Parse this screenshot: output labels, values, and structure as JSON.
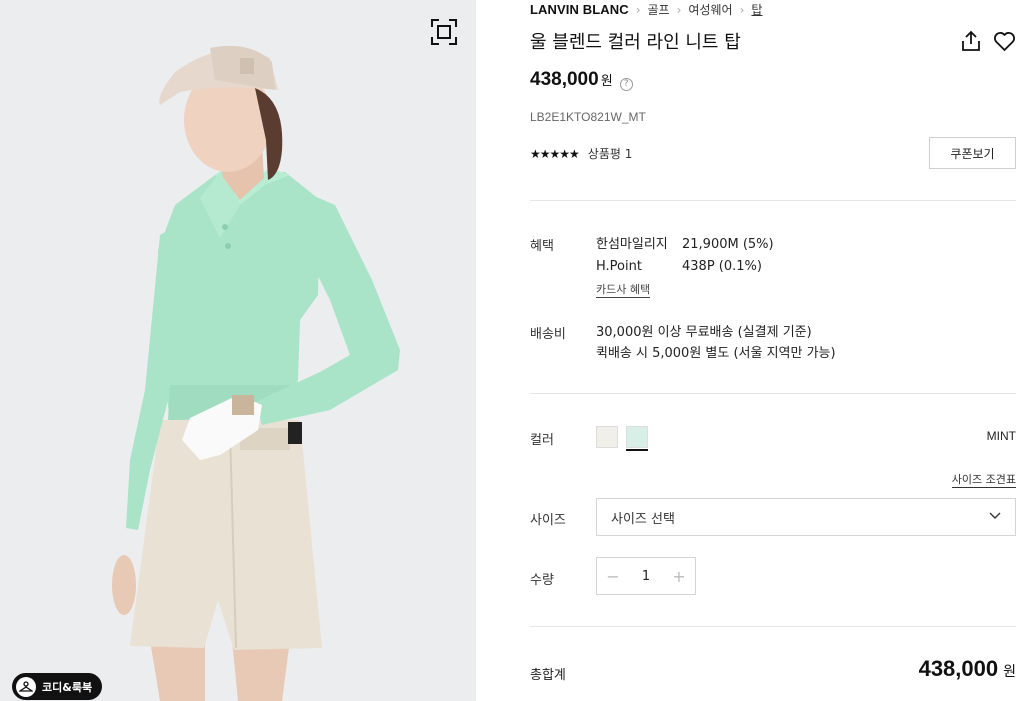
{
  "product_image": {
    "alt": "",
    "lookbook_label": "코디&룩북"
  },
  "breadcrumb": {
    "brand": "LANVIN BLANC",
    "items": [
      "골프",
      "여성웨어",
      "탑"
    ]
  },
  "product": {
    "title": "울 블렌드 컬러 라인 니트 탑",
    "price": "438,000",
    "currency": "원",
    "price_info_icon": "?",
    "code": "LB2E1KTO821W_MT",
    "stars": "★★★★★",
    "review_label": "상품평 1",
    "coupon_label": "쿠폰보기"
  },
  "benefits": {
    "label": "혜택",
    "items": [
      {
        "name": "한섬마일리지",
        "value": "21,900M (5%)"
      },
      {
        "name": "H.Point",
        "value": "438P (0.1%)"
      }
    ],
    "card_link": "카드사 혜택"
  },
  "shipping": {
    "label": "배송비",
    "lines": [
      "30,000원 이상 무료배송 (실결제 기준)",
      "퀵배송 시 5,000원 별도 (서울 지역만 가능)"
    ]
  },
  "color": {
    "label": "컬러",
    "selected_name": "MINT",
    "swatches": [
      {
        "name": "ivory",
        "hex": "#f1efea"
      },
      {
        "name": "mint",
        "hex": "#d8efe8"
      }
    ]
  },
  "size": {
    "label": "사이즈",
    "guide_link": "사이즈 조견표",
    "placeholder": "사이즈 선택"
  },
  "quantity": {
    "label": "수량",
    "minus": "−",
    "value": "1",
    "plus": "+"
  },
  "total": {
    "label": "총합계",
    "price": "438,000",
    "currency": "원"
  },
  "colors": {
    "text": "#111111",
    "divider": "#e6e6e6",
    "photo_bg": "#ecedef",
    "knit_mint": "#a9e4c9",
    "skirt_beige": "#e9e1d3"
  }
}
